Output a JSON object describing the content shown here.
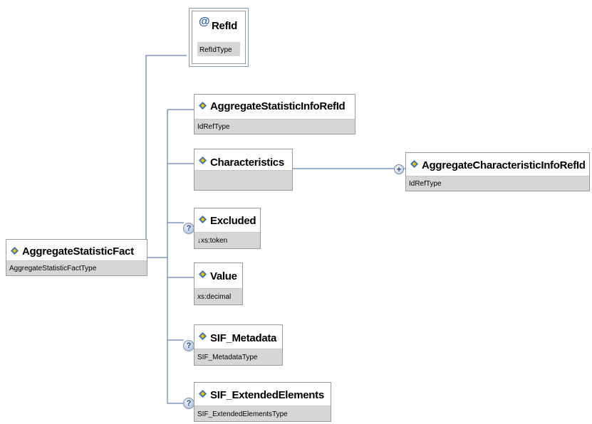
{
  "root": {
    "name": "AggregateStatisticFact",
    "type": "AggregateStatisticFactType"
  },
  "attribute": {
    "symbol": "@",
    "name": "RefId",
    "type": "RefIdType"
  },
  "children": [
    {
      "name": "AggregateStatisticInfoRefId",
      "type": "IdRefType",
      "optional": false
    },
    {
      "name": "Characteristics",
      "type": "",
      "optional": false
    },
    {
      "name": "Excluded",
      "type": "↓xs:token",
      "optional": true
    },
    {
      "name": "Value",
      "type": "xs:decimal",
      "optional": false
    },
    {
      "name": "SIF_Metadata",
      "type": "SIF_MetadataType",
      "optional": true
    },
    {
      "name": "SIF_ExtendedElements",
      "type": "SIF_ExtendedElementsType",
      "optional": true
    }
  ],
  "sub_child": {
    "name": "AggregateCharacteristicInfoRefId",
    "type": "IdRefType"
  },
  "markers": {
    "optional": "?",
    "expand": "+"
  },
  "colors": {
    "line": "#3a6aa8",
    "icon_blue": "#2f6fbf",
    "icon_yellow": "#f2c200",
    "type_bar": "#d6d6d6"
  }
}
